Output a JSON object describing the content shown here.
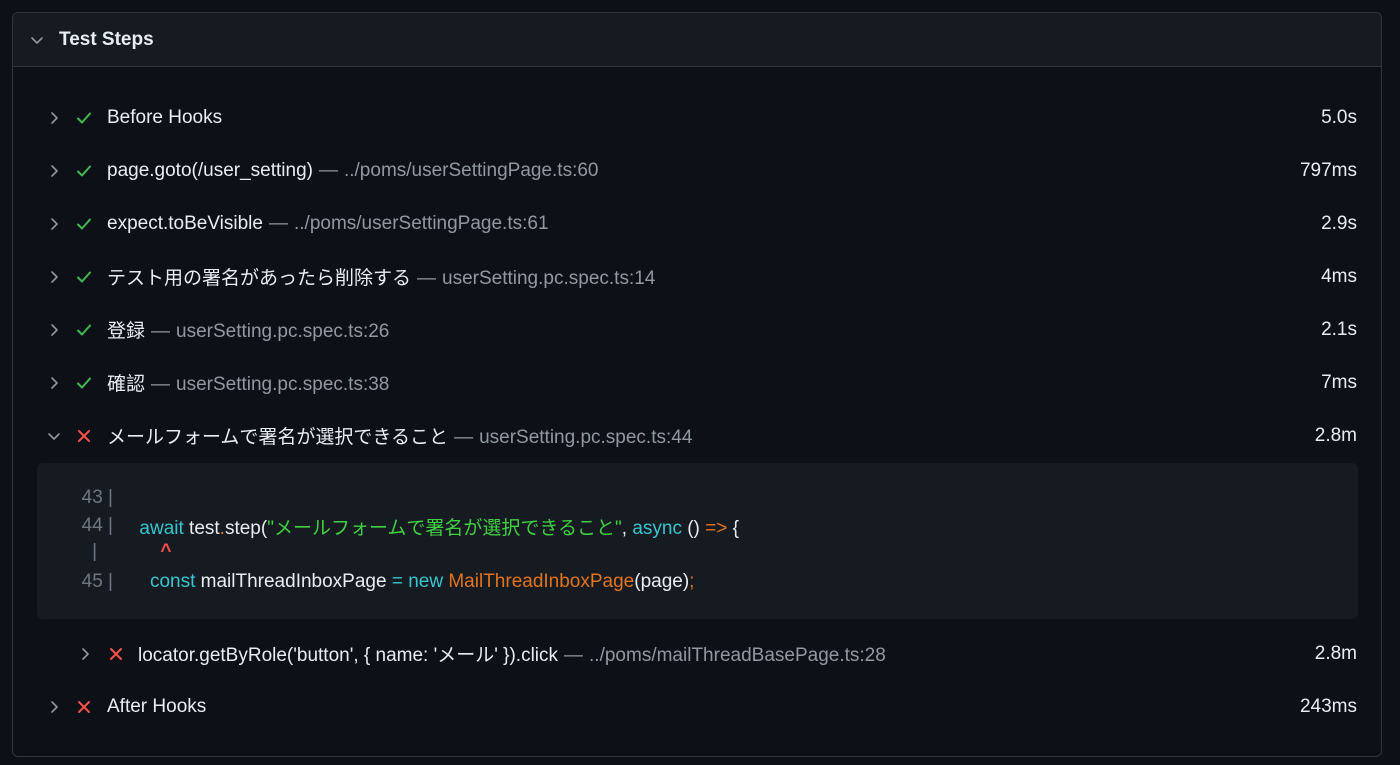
{
  "panel": {
    "title": "Test Steps"
  },
  "steps": [
    {
      "status": "pass",
      "title": "Before Hooks",
      "sep": "",
      "location": "",
      "duration": "5.0s"
    },
    {
      "status": "pass",
      "title": "page.goto(/user_setting)",
      "sep": "—",
      "location": "../poms/userSettingPage.ts:60",
      "duration": "797ms"
    },
    {
      "status": "pass",
      "title": "expect.toBeVisible",
      "sep": "—",
      "location": "../poms/userSettingPage.ts:61",
      "duration": "2.9s"
    },
    {
      "status": "pass",
      "title": "テスト用の署名があったら削除する",
      "sep": "—",
      "location": "userSetting.pc.spec.ts:14",
      "duration": "4ms"
    },
    {
      "status": "pass",
      "title": "登録",
      "sep": "—",
      "location": "userSetting.pc.spec.ts:26",
      "duration": "2.1s"
    },
    {
      "status": "pass",
      "title": "確認",
      "sep": "—",
      "location": "userSetting.pc.spec.ts:38",
      "duration": "7ms"
    },
    {
      "status": "fail",
      "title": "メールフォームで署名が選択できること",
      "sep": "—",
      "location": "userSetting.pc.spec.ts:44",
      "duration": "2.8m",
      "expanded": true
    }
  ],
  "code_snippet": {
    "lines": [
      {
        "number": "43 |"
      },
      {
        "number": "44 |",
        "await": "await",
        "obj": " test",
        "dot": ".",
        "method": "step(",
        "string": "\"メールフォームで署名が選択できること\"",
        "comma": ", ",
        "async": "async",
        "parens": " () ",
        "arrow": "=>",
        "brace": " {"
      },
      {
        "number": "|",
        "caret": "^"
      },
      {
        "number": "45 |",
        "const": "const",
        "var": " mailThreadInboxPage ",
        "eq": "=",
        "new": " new ",
        "cls": "MailThreadInboxPage",
        "args": "(page)",
        "semi": ";"
      }
    ]
  },
  "substeps": [
    {
      "status": "fail",
      "title": "locator.getByRole('button', { name: 'メール' }).click",
      "sep": "—",
      "location": "../poms/mailThreadBasePage.ts:28",
      "duration": "2.8m"
    }
  ],
  "after_hooks": {
    "status": "fail",
    "title": "After Hooks",
    "duration": "243ms"
  },
  "colors": {
    "pass": "#3fb950",
    "fail": "#f85149",
    "background": "#0d1117",
    "header": "#161b22",
    "border": "#30363d"
  }
}
